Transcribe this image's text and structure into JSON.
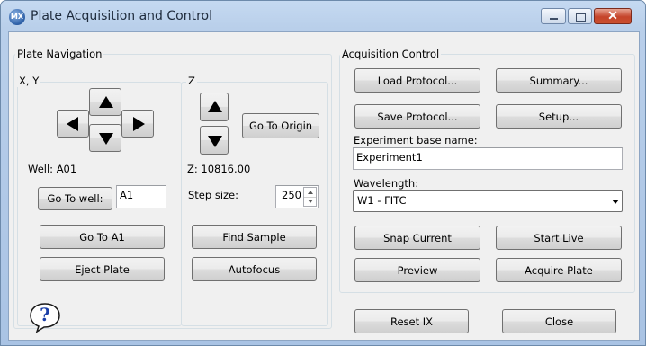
{
  "window": {
    "title": "Plate Acquisition and Control",
    "app_icon_text": "MX",
    "close_glyph": "✕"
  },
  "plate_navigation": {
    "label": "Plate Navigation",
    "xy_label": "X, Y",
    "z_label": "Z",
    "well_text": "Well: A01",
    "z_text": "Z: 10816.00",
    "go_to_origin": "Go To Origin",
    "go_to_well": "Go To well:",
    "well_value": "A1",
    "step_size_label": "Step size:",
    "step_size_value": "250",
    "go_to_a1": "Go To A1",
    "find_sample": "Find Sample",
    "eject_plate": "Eject Plate",
    "autofocus": "Autofocus"
  },
  "acquisition_control": {
    "label": "Acquisition Control",
    "load_protocol": "Load Protocol...",
    "summary": "Summary...",
    "save_protocol": "Save Protocol...",
    "setup": "Setup...",
    "experiment_label": "Experiment base name:",
    "experiment_value": "Experiment1",
    "wavelength_label": "Wavelength:",
    "wavelength_value": "W1 - FITC",
    "snap_current": "Snap Current",
    "start_live": "Start Live",
    "preview": "Preview",
    "acquire_plate": "Acquire Plate"
  },
  "footer": {
    "help_glyph": "?",
    "reset_ix": "Reset IX",
    "close": "Close"
  },
  "colors": {
    "title_bar": "#b9cfea",
    "client_bg": "#f0f0f0",
    "close_red": "#c5442a"
  }
}
